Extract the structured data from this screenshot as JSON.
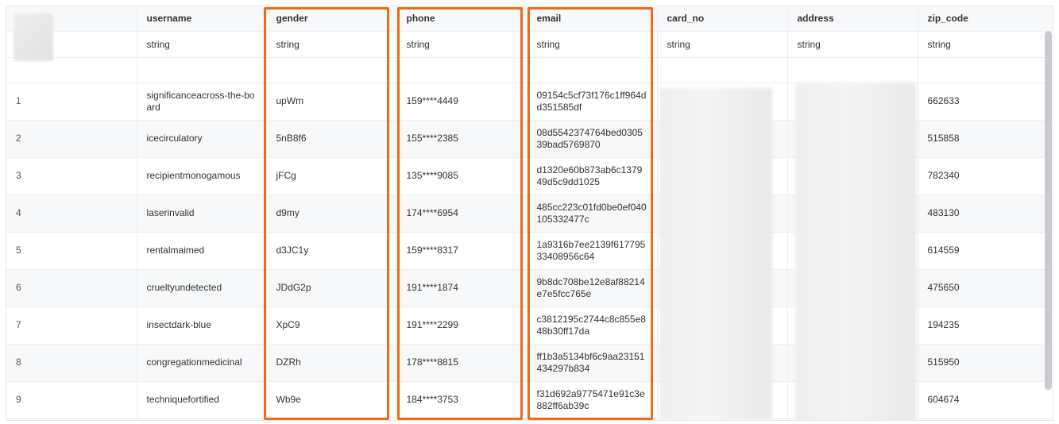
{
  "table": {
    "columns": [
      "",
      "username",
      "gender",
      "phone",
      "email",
      "card_no",
      "address",
      "zip_code"
    ],
    "types": [
      "",
      "string",
      "string",
      "string",
      "string",
      "string",
      "string",
      "string"
    ],
    "rows": [
      {
        "idx": "1",
        "username": "significanceacross-the-board",
        "gender": "upWm",
        "phone": "159****4449",
        "email": "09154c5cf73f176c1ff964dd351585df",
        "card_no": "",
        "address": "",
        "zip_code": "662633"
      },
      {
        "idx": "2",
        "username": "icecirculatory",
        "gender": "5nB8f6",
        "phone": "155****2385",
        "email": "08d5542374764bed030539bad5769870",
        "card_no": "",
        "address": "",
        "zip_code": "515858"
      },
      {
        "idx": "3",
        "username": "recipientmonogamous",
        "gender": "jFCg",
        "phone": "135****9085",
        "email": "d1320e60b873ab6c137949d5c9dd1025",
        "card_no": "",
        "address": "",
        "zip_code": "782340"
      },
      {
        "idx": "4",
        "username": "laserinvalid",
        "gender": "d9my",
        "phone": "174****6954",
        "email": "485cc223c01fd0be0ef040105332477c",
        "card_no": "",
        "address": "",
        "zip_code": "483130"
      },
      {
        "idx": "5",
        "username": "rentalmaimed",
        "gender": "d3JC1y",
        "phone": "159****8317",
        "email": "1a9316b7ee2139f61779533408956c64",
        "card_no": "",
        "address": "",
        "zip_code": "614559"
      },
      {
        "idx": "6",
        "username": "crueltyundetected",
        "gender": "JDdG2p",
        "phone": "191****1874",
        "email": "9b8dc708be12e8af88214e7e5fcc765e",
        "card_no": "",
        "address": "",
        "zip_code": "475650"
      },
      {
        "idx": "7",
        "username": "insectdark-blue",
        "gender": "XpC9",
        "phone": "191****2299",
        "email": "c3812195c2744c8c855e848b30ff17da",
        "card_no": "",
        "address": "",
        "zip_code": "194235"
      },
      {
        "idx": "8",
        "username": "congregationmedicinal",
        "gender": "DZRh",
        "phone": "178****8815",
        "email": "ff1b3a5134bf6c9aa23151434297b834",
        "card_no": "",
        "address": "",
        "zip_code": "515950"
      },
      {
        "idx": "9",
        "username": "techniquefortified",
        "gender": "Wb9e",
        "phone": "184****3753",
        "email": "f31d692a9775471e91c3e882ff6ab39c",
        "card_no": "",
        "address": "",
        "zip_code": "604674"
      }
    ]
  },
  "highlight_color": "#f06a17",
  "highlighted_columns": [
    "gender",
    "phone",
    "email"
  ]
}
